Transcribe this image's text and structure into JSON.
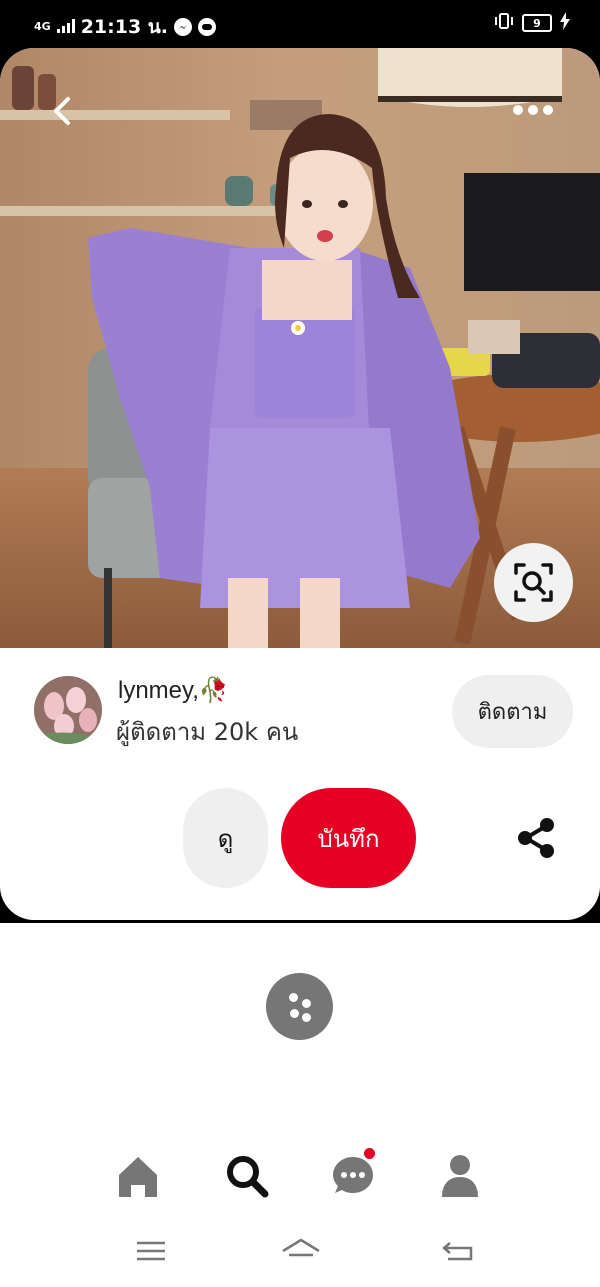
{
  "status_bar": {
    "network": "4G",
    "time": "21:13 น.",
    "battery": "9"
  },
  "creator": {
    "name": "lynmey,🥀",
    "followers": "ผู้ติดตาม 20k คน",
    "follow_label": "ติดตาม"
  },
  "actions": {
    "view_label": "ดู",
    "save_label": "บันทึก"
  },
  "colors": {
    "save_red": "#e60023",
    "button_gray": "#efefef",
    "loader_gray": "#767676",
    "notification_dot": "#e60023"
  },
  "icons": {
    "back": "chevron-left-icon",
    "more": "more-dots-icon",
    "visual_search": "visual-search-icon",
    "share": "share-icon",
    "home": "home-icon",
    "search": "search-icon",
    "messages": "chat-icon",
    "profile": "profile-icon"
  }
}
